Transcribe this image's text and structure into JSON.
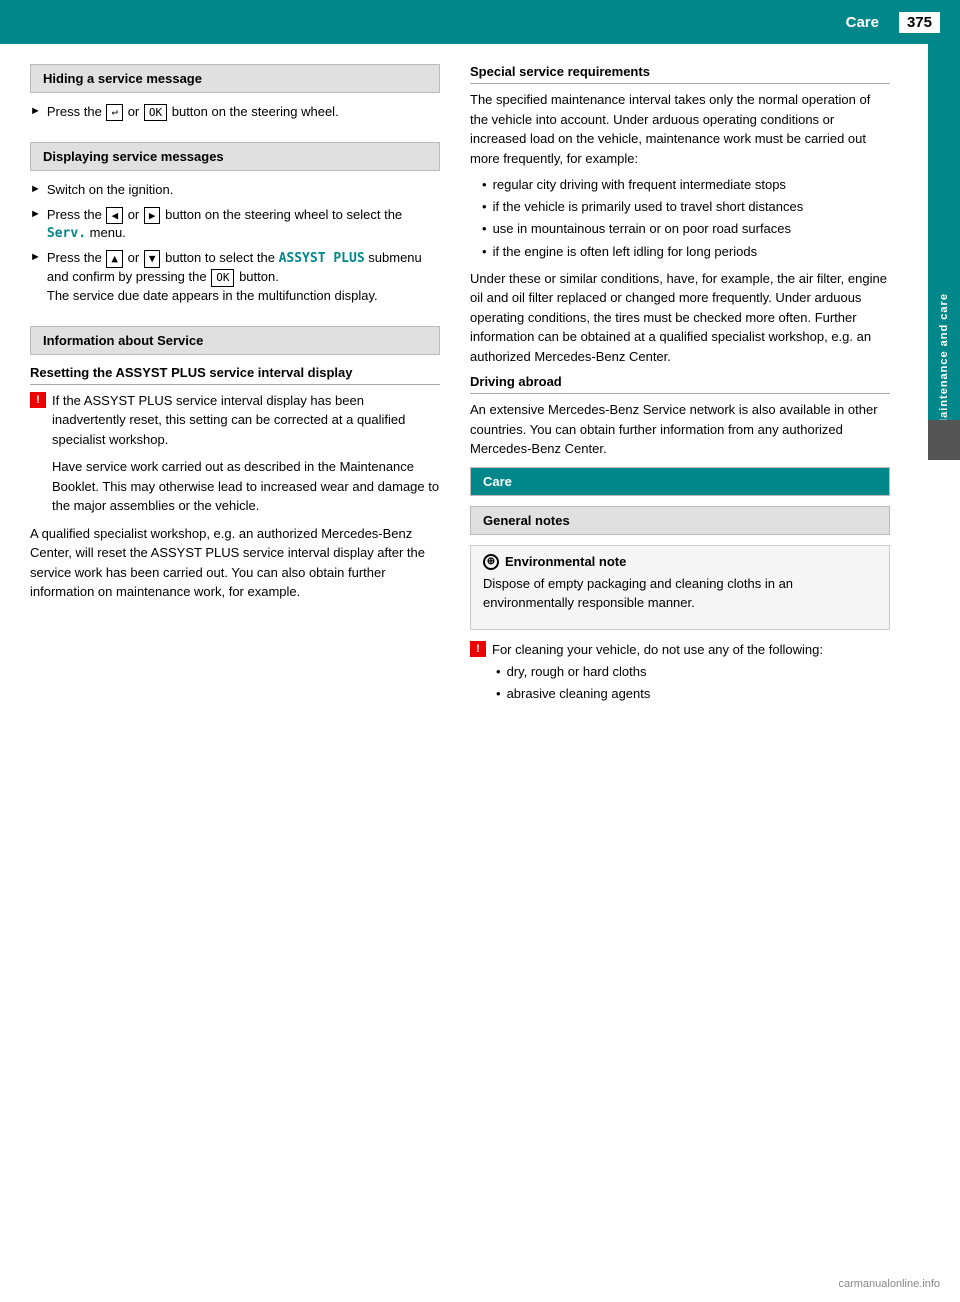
{
  "header": {
    "section": "Care",
    "page_number": "375"
  },
  "side_tab": {
    "label": "Maintenance and care"
  },
  "left_column": {
    "hiding_service_message": {
      "title": "Hiding a service message",
      "step1": "Press the",
      "step1_key1": "↩",
      "step1_or": "or",
      "step1_key2": "OK",
      "step1_end": "button on the steering wheel."
    },
    "displaying_service_messages": {
      "title": "Displaying service messages",
      "step1": "Switch on the ignition.",
      "step2_start": "Press the",
      "step2_key1": "◄",
      "step2_or": "or",
      "step2_key2": "►",
      "step2_end": "button on the steering wheel to select the",
      "step2_menu": "Serv.",
      "step2_menu_end": "menu.",
      "step3_start": "Press the",
      "step3_key1": "▲",
      "step3_or": "or",
      "step3_key2": "▼",
      "step3_mid": "button to select the",
      "step3_menu": "ASSYST PLUS",
      "step3_end": "submenu and confirm by pressing the",
      "step3_key3": "OK",
      "step3_end2": "button.",
      "step3_result": "The service due date appears in the multifunction display."
    },
    "information_about_service": {
      "title": "Information about Service",
      "resetting_title": "Resetting the ASSYST PLUS service interval display",
      "warning1_start": "If the ASSYST PLUS service interval display has been inadvertently reset, this setting can be corrected at a qualified specialist workshop.",
      "warning1_cont": "Have service work carried out as described in the Maintenance Booklet. This may otherwise lead to increased wear and damage to the major assemblies or the vehicle.",
      "para1": "A qualified specialist workshop, e.g. an authorized Mercedes-Benz Center, will reset the ASSYST PLUS service interval display after the service work has been carried out. You can also obtain further information on maintenance work, for example."
    }
  },
  "right_column": {
    "special_service_requirements": {
      "title": "Special service requirements",
      "para1": "The specified maintenance interval takes only the normal operation of the vehicle into account. Under arduous operating conditions or increased load on the vehicle, maintenance work must be carried out more frequently, for example:",
      "bullets": [
        "regular city driving with frequent intermediate stops",
        "if the vehicle is primarily used to travel short distances",
        "use in mountainous terrain or on poor road surfaces",
        "if the engine is often left idling for long periods"
      ],
      "para2": "Under these or similar conditions, have, for example, the air filter, engine oil and oil filter replaced or changed more frequently. Under arduous operating conditions, the tires must be checked more often. Further information can be obtained at a qualified specialist workshop, e.g. an authorized Mercedes-Benz Center."
    },
    "driving_abroad": {
      "title": "Driving abroad",
      "para1": "An extensive Mercedes-Benz Service network is also available in other countries. You can obtain further information from any authorized Mercedes-Benz Center."
    },
    "care_section": {
      "title": "Care",
      "general_notes": {
        "title": "General notes",
        "env_note_title": "Environmental note",
        "env_note_text": "Dispose of empty packaging and cleaning cloths in an environmentally responsible manner.",
        "warning_text": "For cleaning your vehicle, do not use any of the following:",
        "bullets": [
          "dry, rough or hard cloths",
          "abrasive cleaning agents"
        ]
      }
    }
  },
  "watermark": "carmanualonline.info"
}
